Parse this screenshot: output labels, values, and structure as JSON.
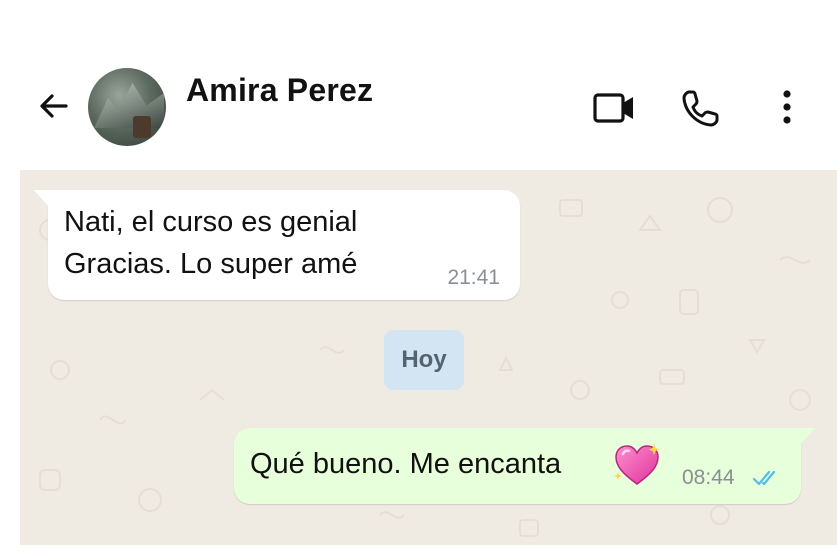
{
  "header": {
    "contact_name": "Amira Perez",
    "back_icon": "arrow-left-icon",
    "video_icon": "video-camera-icon",
    "call_icon": "phone-icon",
    "menu_icon": "more-vertical-icon"
  },
  "messages": [
    {
      "direction": "incoming",
      "lines": [
        "Nati, el curso es genial",
        "Gracias. Lo super amé"
      ],
      "time": "21:41"
    },
    {
      "direction": "outgoing",
      "lines": [
        "Qué bueno. Me encanta"
      ],
      "emoji": "sparkling-heart-emoji",
      "time": "08:44",
      "status": "read-double-check-icon"
    }
  ],
  "date_separator": "Hoy",
  "colors": {
    "chat_background": "#efeae2",
    "incoming_bubble": "#ffffff",
    "outgoing_bubble": "#e7ffdb",
    "date_chip": "#d3e5f2",
    "read_ticks": "#53bdeb"
  }
}
